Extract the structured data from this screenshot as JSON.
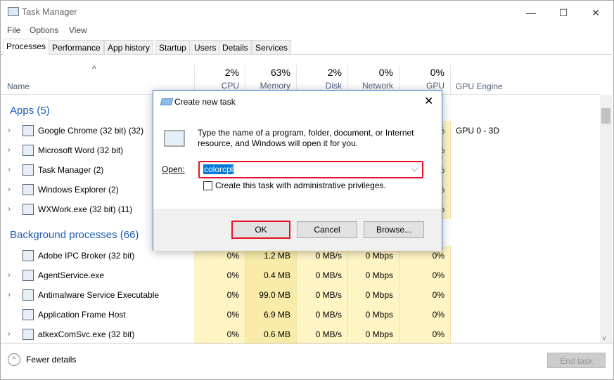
{
  "window": {
    "title": "Task Manager",
    "minimize": "—",
    "maximize": "☐",
    "close": "✕"
  },
  "menu": [
    "File",
    "Options",
    "View"
  ],
  "tabs": [
    "Processes",
    "Performance",
    "App history",
    "Startup",
    "Users",
    "Details",
    "Services"
  ],
  "columns": {
    "name": "Name",
    "cpu": {
      "pct": "2%",
      "label": "CPU"
    },
    "memory": {
      "pct": "63%",
      "label": "Memory"
    },
    "disk": {
      "pct": "2%",
      "label": "Disk"
    },
    "network": {
      "pct": "0%",
      "label": "Network"
    },
    "gpu": {
      "pct": "0%",
      "label": "GPU"
    },
    "gpu_engine": "GPU Engine"
  },
  "apps": {
    "header": "Apps (5)",
    "rows": [
      {
        "name": "Google Chrome (32 bit) (32)",
        "gpu": "0%",
        "engine": "GPU 0 - 3D"
      },
      {
        "name": "Microsoft Word (32 bit)",
        "gpu": "0%",
        "engine": ""
      },
      {
        "name": "Task Manager (2)",
        "gpu": "0%",
        "engine": ""
      },
      {
        "name": "Windows Explorer (2)",
        "gpu": "0%",
        "engine": ""
      },
      {
        "name": "WXWork.exe (32 bit) (11)",
        "gpu": "0%",
        "engine": ""
      }
    ]
  },
  "background": {
    "header": "Background processes (66)",
    "rows": [
      {
        "name": "Adobe IPC Broker (32 bit)",
        "cpu": "0%",
        "mem": "1.2 MB",
        "disk": "0 MB/s",
        "net": "0 Mbps",
        "gpu": "0%",
        "expand": false
      },
      {
        "name": "AgentService.exe",
        "cpu": "0%",
        "mem": "0.4 MB",
        "disk": "0 MB/s",
        "net": "0 Mbps",
        "gpu": "0%",
        "expand": true
      },
      {
        "name": "Antimalware Service Executable",
        "cpu": "0%",
        "mem": "99.0 MB",
        "disk": "0 MB/s",
        "net": "0 Mbps",
        "gpu": "0%",
        "expand": true
      },
      {
        "name": "Application Frame Host",
        "cpu": "0%",
        "mem": "6.9 MB",
        "disk": "0 MB/s",
        "net": "0 Mbps",
        "gpu": "0%",
        "expand": false
      },
      {
        "name": "atkexComSvc.exe (32 bit)",
        "cpu": "0%",
        "mem": "0.6 MB",
        "disk": "0 MB/s",
        "net": "0 Mbps",
        "gpu": "0%",
        "expand": true
      }
    ]
  },
  "footer": {
    "fewer": "Fewer details",
    "end_task": "End task"
  },
  "dialog": {
    "title": "Create new task",
    "message": "Type the name of a program, folder, document, or Internet resource, and Windows will open it for you.",
    "open_label": "Open:",
    "open_value": "colorcpl",
    "admin_label": "Create this task with administrative privileges.",
    "admin_checked": false,
    "ok": "OK",
    "cancel": "Cancel",
    "browse": "Browse...",
    "highlight_color": "#e81123"
  }
}
